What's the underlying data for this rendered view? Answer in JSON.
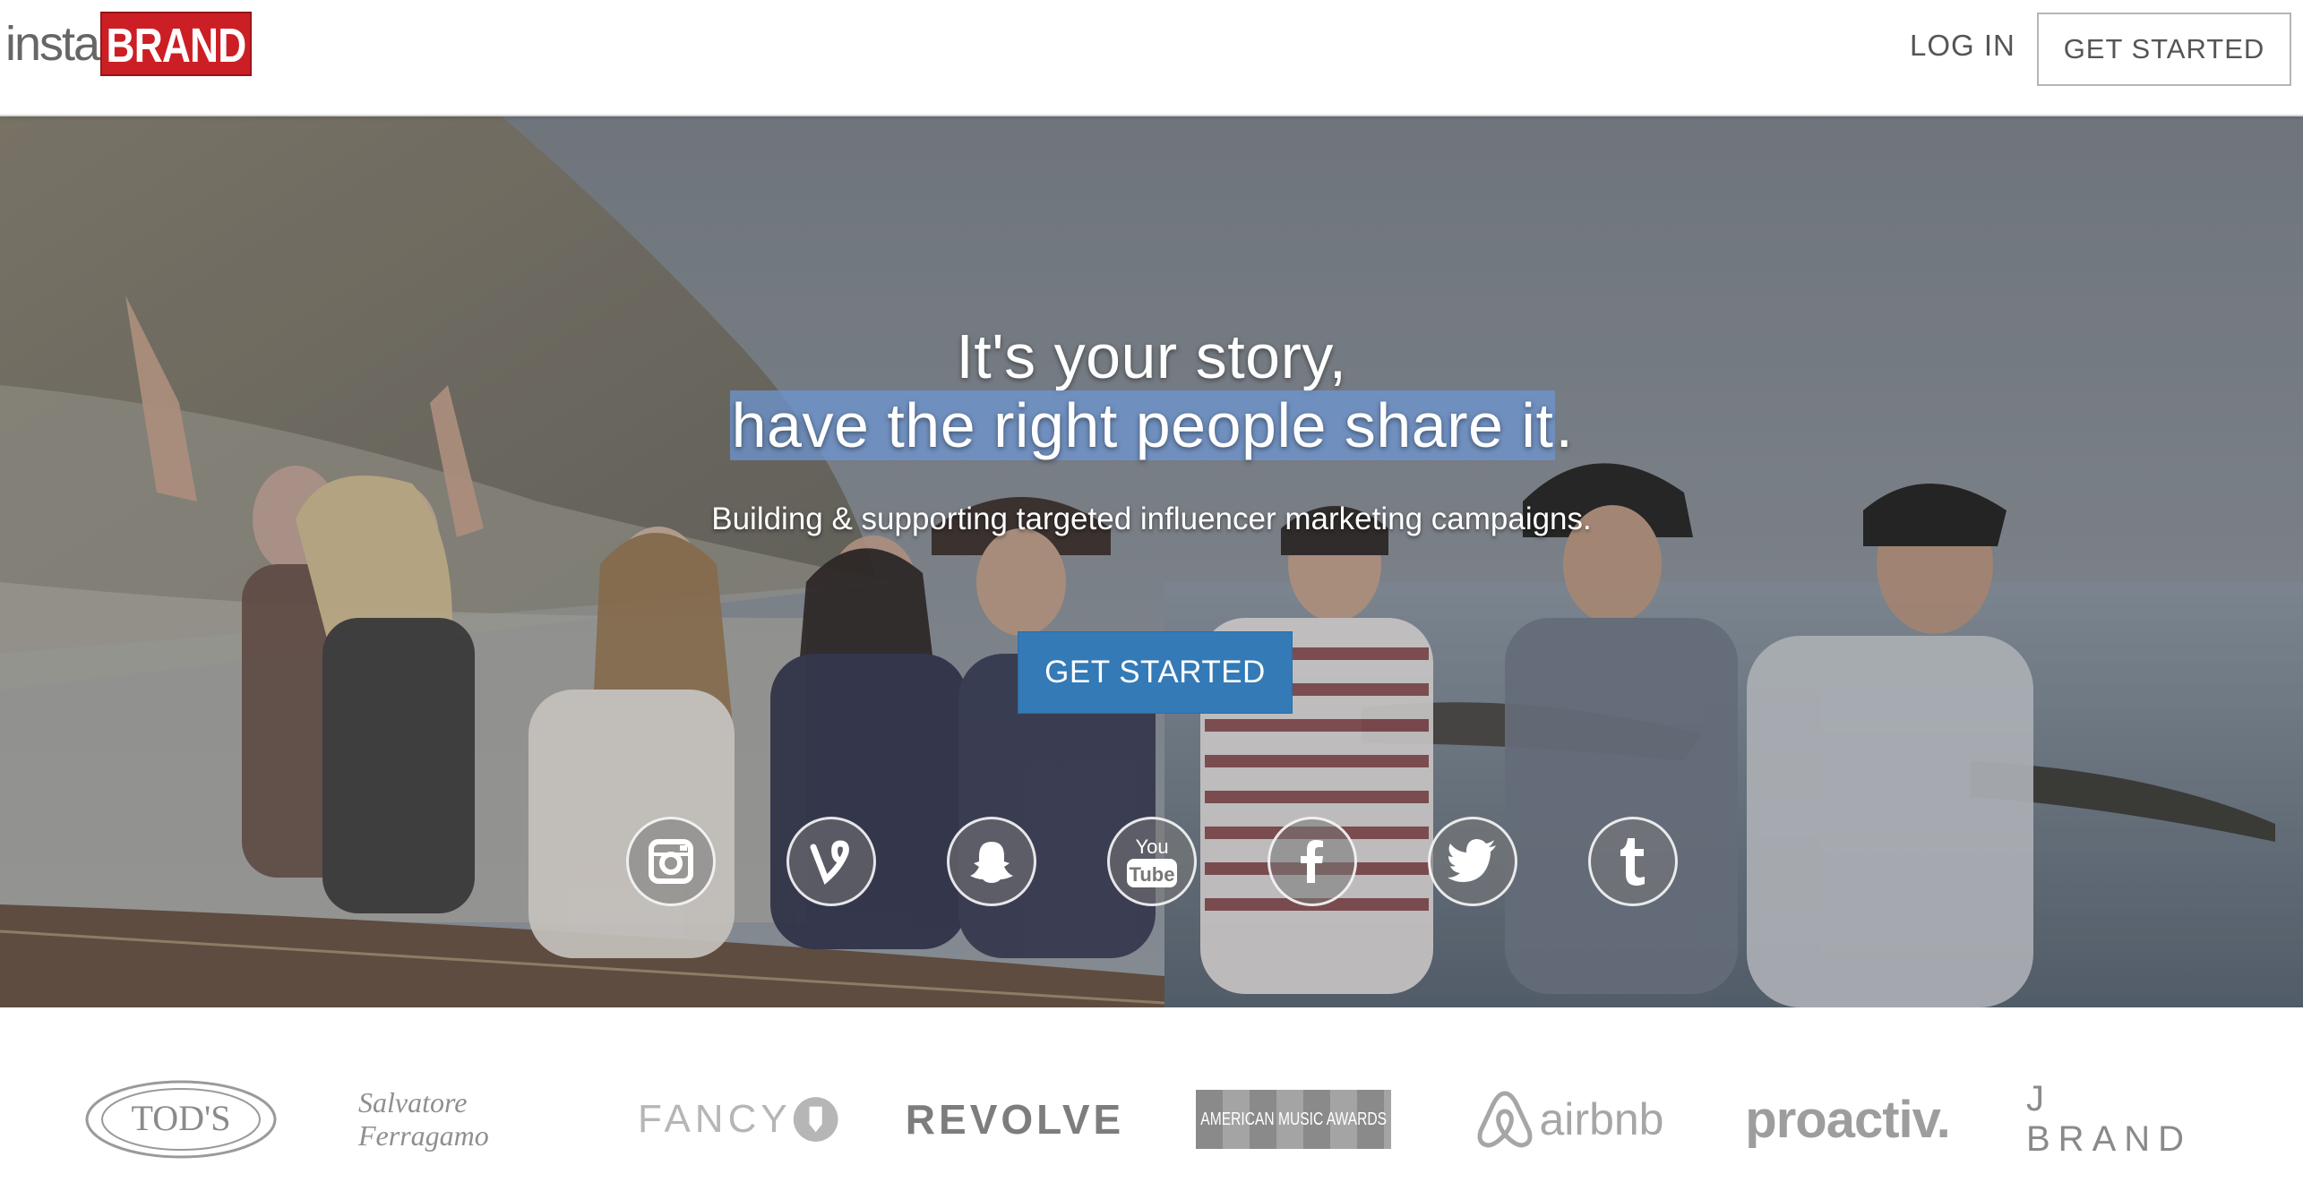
{
  "header": {
    "logo_left": "insta",
    "logo_right": "BRAND",
    "login_label": "LOG IN",
    "cta_label": "GET STARTED"
  },
  "hero": {
    "headline_line1": "It's your story,",
    "headline_line2_selected": "have the right people share it",
    "headline_line2_tail": ".",
    "subheadline": "Building & supporting targeted influencer marketing campaigns.",
    "cta_label": "GET STARTED",
    "social_icons": [
      "instagram-icon",
      "vine-icon",
      "snapchat-icon",
      "youtube-icon",
      "facebook-icon",
      "twitter-icon",
      "tumblr-icon"
    ],
    "youtube_text_top": "You",
    "youtube_text_bottom": "Tube"
  },
  "brands": {
    "tods": "TOD'S",
    "ferragamo": "Salvatore Ferragamo",
    "fancy": "FANCY",
    "revolve": "REVOLVE",
    "ama": "AMERICAN MUSIC AWARDS",
    "airbnb": "airbnb",
    "proactiv": "proactiv.",
    "jbrand": "J BRAND"
  },
  "colors": {
    "brand_red": "#cc1f25",
    "cta_blue": "#337ab7",
    "selection": "#6e96d2"
  }
}
